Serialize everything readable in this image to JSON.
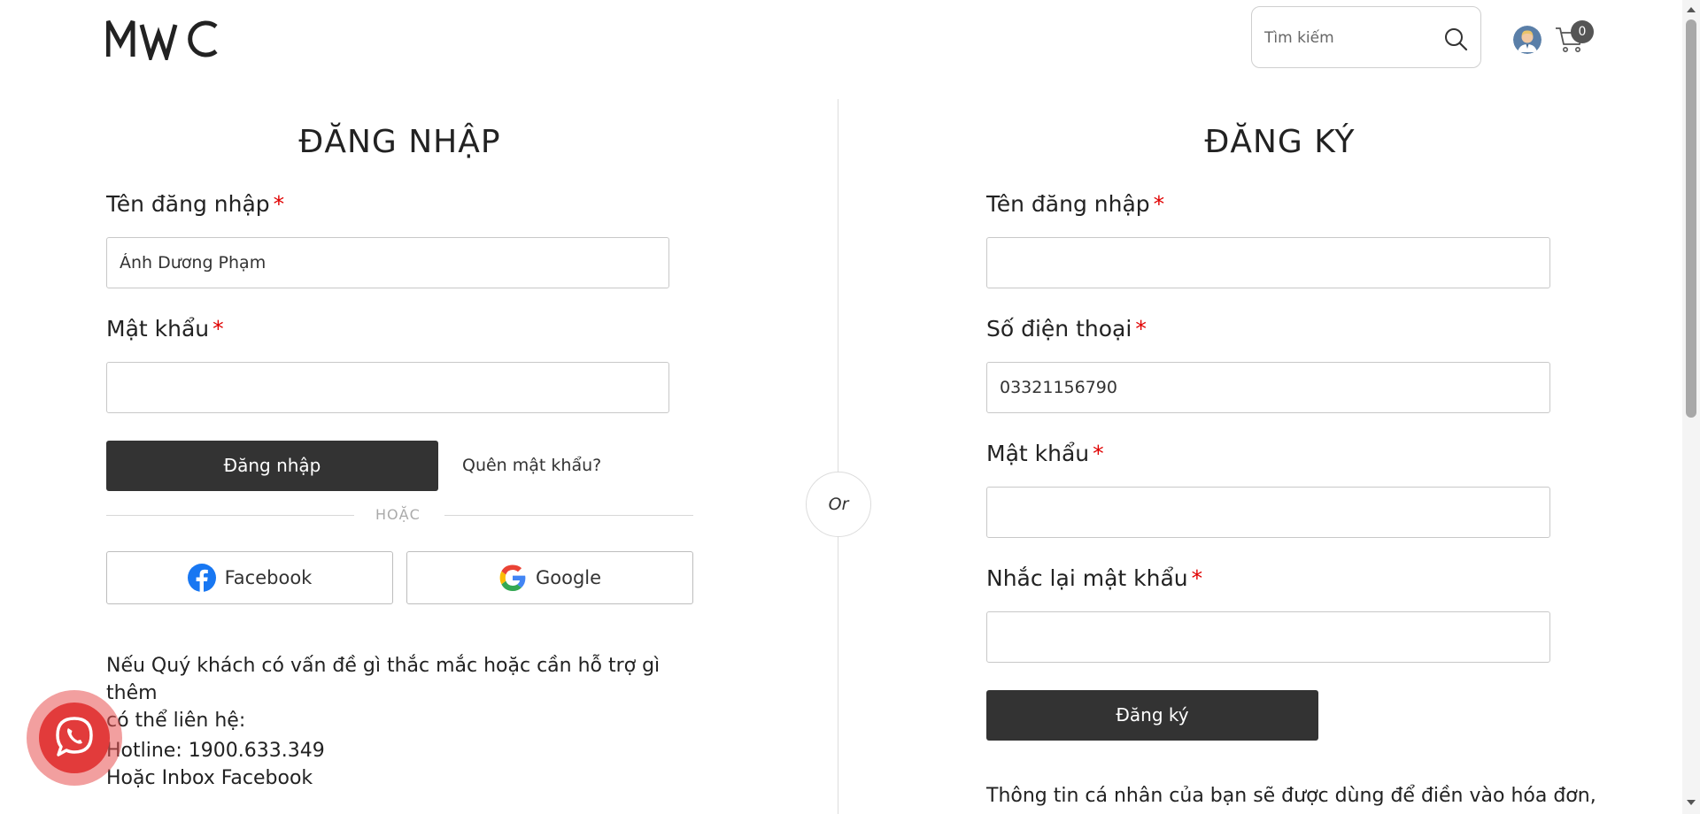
{
  "header": {
    "logo_text": "MWC",
    "search_placeholder": "Tìm kiếm",
    "cart_count": "0"
  },
  "login": {
    "title": "ĐĂNG NHẬP",
    "username_label": "Tên đăng nhập",
    "username_value": "Ánh Dương Phạm",
    "password_label": "Mật khẩu",
    "password_value": "",
    "required_mark": "*",
    "submit_label": "Đăng nhập",
    "forgot_label": "Quên mật khẩu?",
    "or_label": "HOẶC",
    "facebook_label": "Facebook",
    "google_label": "Google",
    "help_line1": "Nếu Quý khách có vấn đề gì thắc mắc hoặc cần hỗ trợ gì thêm",
    "help_line2": "có thể liên hệ:",
    "hotline": "Hotline: 1900.633.349",
    "inbox": "Hoặc Inbox Facebook"
  },
  "divider": {
    "or_label": "Or"
  },
  "register": {
    "title": "ĐĂNG KÝ",
    "username_label": "Tên đăng nhập",
    "username_value": "",
    "phone_label": "Số điện thoại",
    "phone_value": "03321156790",
    "password_label": "Mật khẩu",
    "password_value": "",
    "confirm_label": "Nhắc lại mật khẩu",
    "confirm_value": "",
    "required_mark": "*",
    "submit_label": "Đăng ký",
    "note": "Thông tin cá nhân của bạn sẽ được dùng để điền vào hóa đơn,"
  },
  "colors": {
    "button_dark": "#333333",
    "required": "#e00000",
    "call_widget": "#e23b3b"
  }
}
